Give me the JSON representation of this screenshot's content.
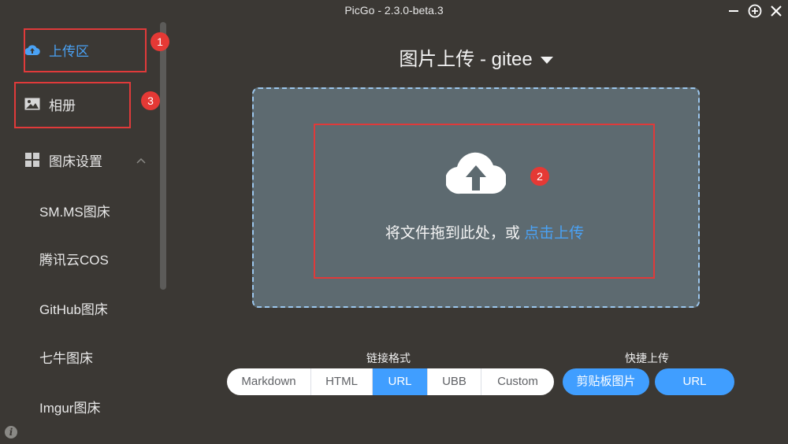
{
  "window": {
    "title": "PicGo - 2.3.0-beta.3"
  },
  "sidebar": {
    "upload_label": "上传区",
    "gallery_label": "相册",
    "picbed_settings_label": "图床设置",
    "sub_items": [
      "SM.MS图床",
      "腾讯云COS",
      "GitHub图床",
      "七牛图床",
      "Imgur图床"
    ]
  },
  "annotations": [
    "1",
    "2",
    "3"
  ],
  "main": {
    "title": "图片上传 - gitee",
    "drop_text": "将文件拖到此处，或 ",
    "drop_link": "点击上传"
  },
  "link_format": {
    "label": "链接格式",
    "options": [
      "Markdown",
      "HTML",
      "URL",
      "UBB",
      "Custom"
    ],
    "selected": "URL"
  },
  "quick_upload": {
    "label": "快捷上传",
    "clipboard_label": "剪贴板图片",
    "url_label": "URL"
  },
  "colors": {
    "accent": "#409eff",
    "annotation": "#e53935",
    "background": "#3b3834"
  },
  "icons": [
    "minimize-icon",
    "plus-circle-icon",
    "close-icon",
    "upload-cloud-icon",
    "image-icon",
    "grid-icon",
    "chevron-up-icon",
    "info-icon"
  ]
}
